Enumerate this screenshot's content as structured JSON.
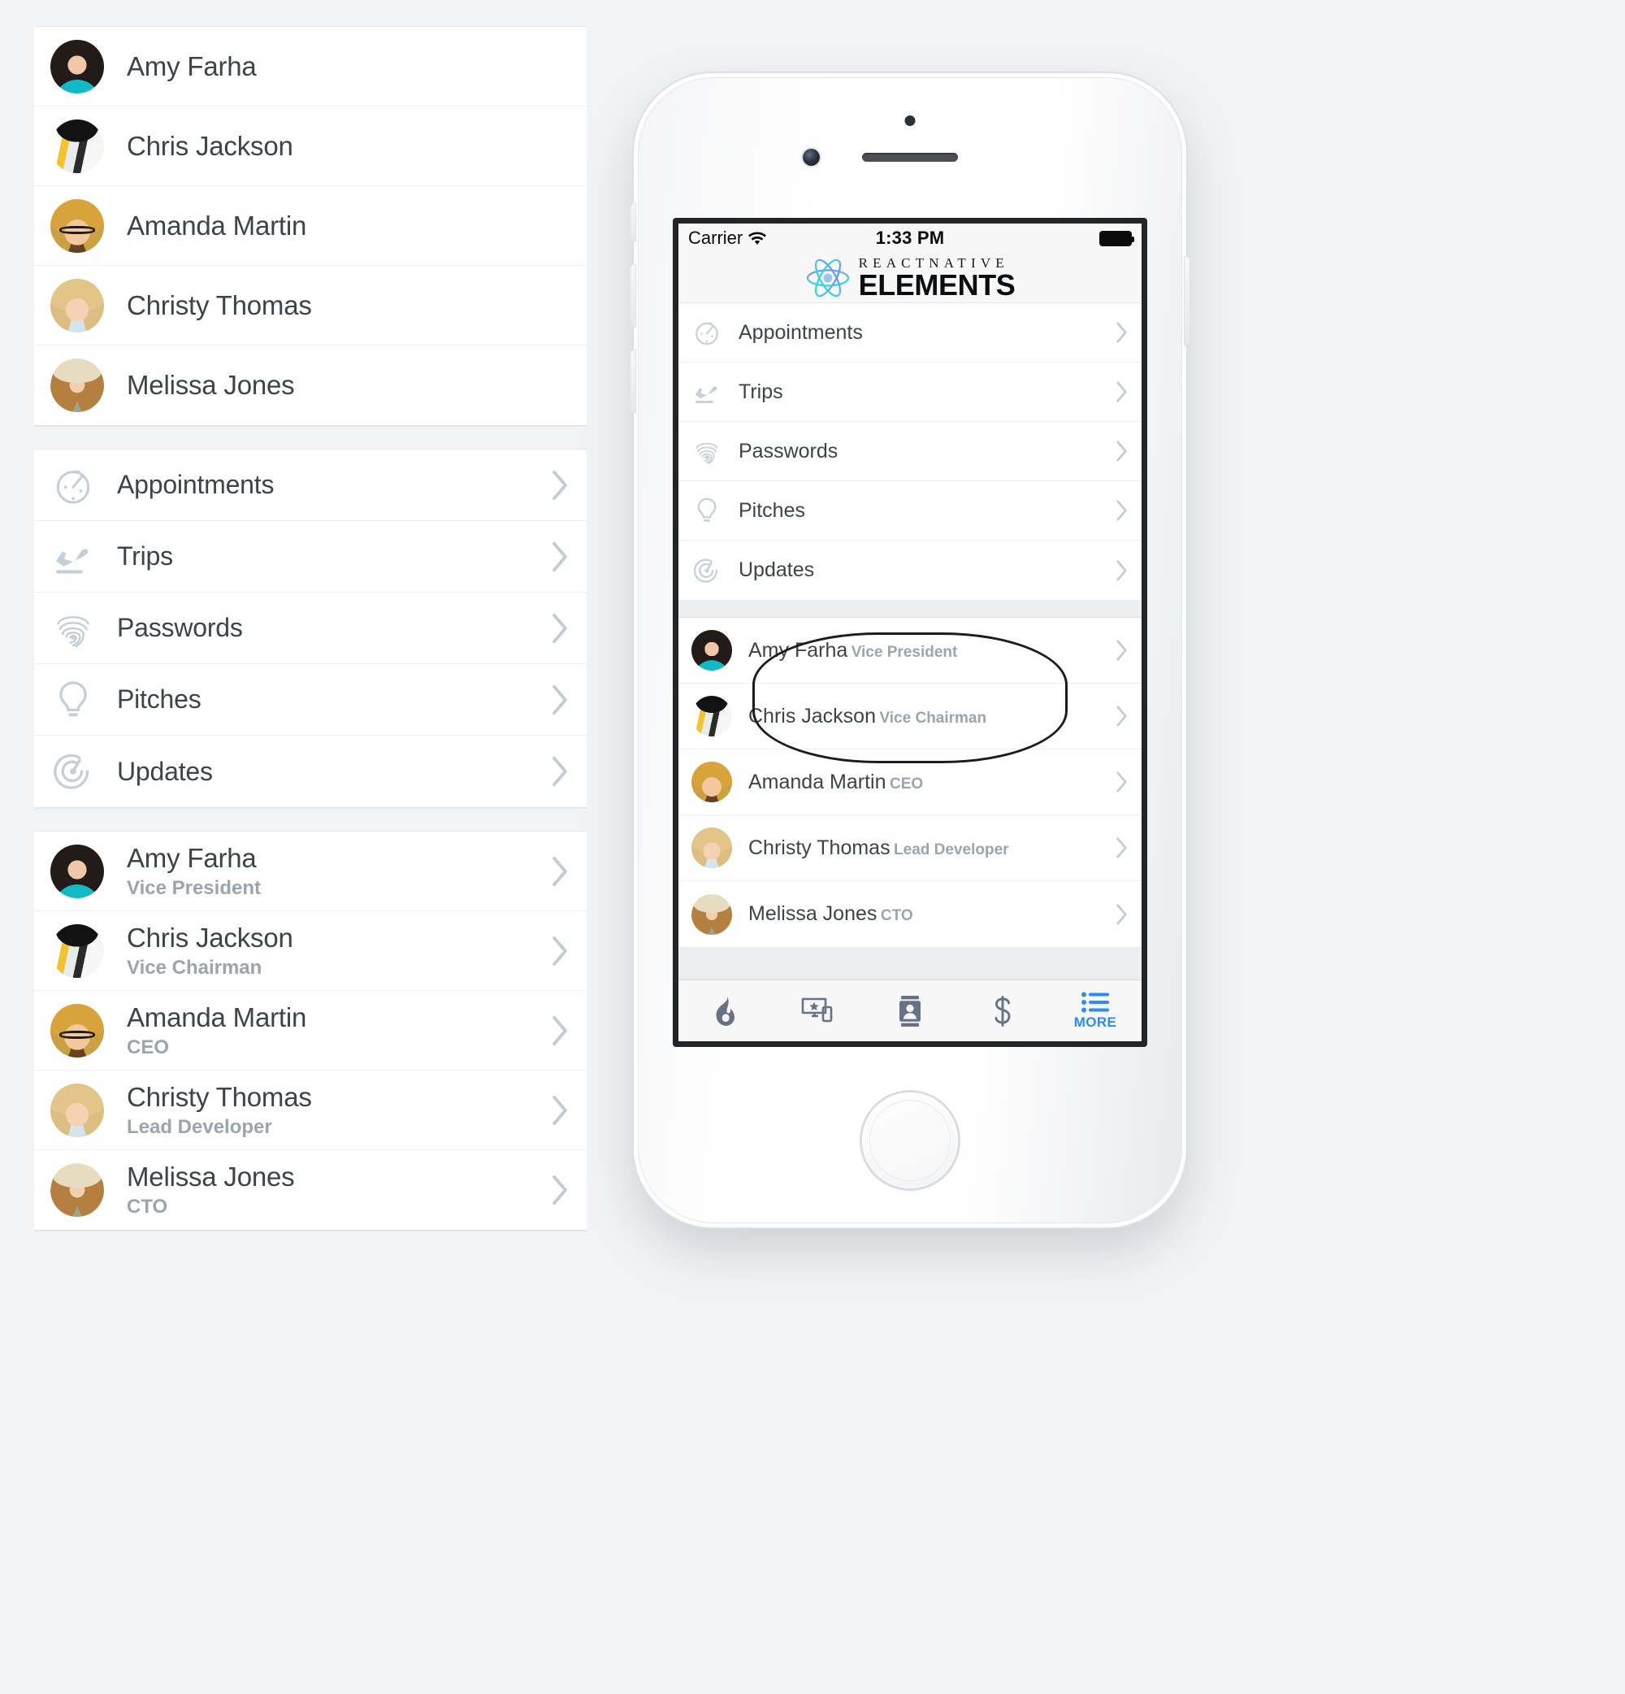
{
  "people": [
    {
      "name": "Amy Farha",
      "role": "Vice President",
      "avatar": "ph-amy"
    },
    {
      "name": "Chris Jackson",
      "role": "Vice Chairman",
      "avatar": "ph-chris"
    },
    {
      "name": "Amanda Martin",
      "role": "CEO",
      "avatar": "ph-amanda"
    },
    {
      "name": "Christy Thomas",
      "role": "Lead Developer",
      "avatar": "ph-christy"
    },
    {
      "name": "Melissa Jones",
      "role": "CTO",
      "avatar": "ph-melissa"
    }
  ],
  "menu": [
    {
      "label": "Appointments",
      "icon": "stopwatch-icon"
    },
    {
      "label": "Trips",
      "icon": "airplane-takeoff-icon"
    },
    {
      "label": "Passwords",
      "icon": "fingerprint-icon"
    },
    {
      "label": "Pitches",
      "icon": "lightbulb-icon"
    },
    {
      "label": "Updates",
      "icon": "radar-icon"
    }
  ],
  "phone": {
    "statusbar": {
      "carrier": "Carrier",
      "wifi_icon": "wifi-icon",
      "time": "1:33 PM",
      "battery_icon": "battery-full-icon"
    },
    "header": {
      "logo_icon": "react-atom-icon",
      "brand_top": "REACTNATIVE",
      "brand_main": "ELEMENTS"
    },
    "tabbar": {
      "tabs": [
        {
          "label": "",
          "icon": "flame-icon",
          "active": false
        },
        {
          "label": "",
          "icon": "devices-star-icon",
          "active": false
        },
        {
          "label": "",
          "icon": "contact-card-icon",
          "active": false
        },
        {
          "label": "",
          "icon": "dollar-icon",
          "active": false
        },
        {
          "label": "MORE",
          "icon": "list-icon",
          "active": true
        }
      ]
    }
  },
  "colors": {
    "accent": "#2d8cf0",
    "title_text": "#3d4448",
    "sub_text": "#9aa5ad",
    "icon_grey": "#c6ced6",
    "chevron": "#c3ccd3",
    "page_bg": "#f2f3f5",
    "card_bg": "#ffffff"
  },
  "icon_glyphs": {
    "chevron_right": "›"
  }
}
